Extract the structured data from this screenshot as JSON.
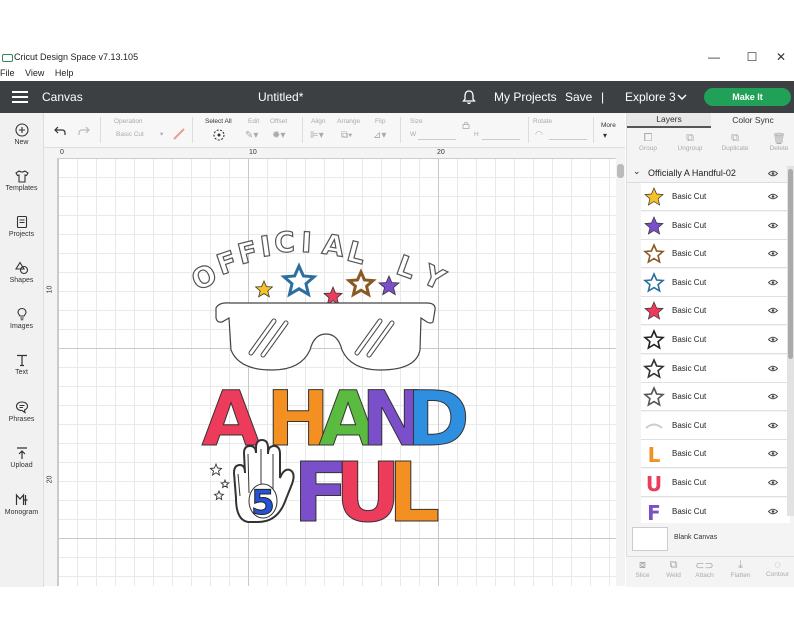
{
  "window": {
    "title": "Cricut Design Space  v7.13.105",
    "menu": [
      "File",
      "View",
      "Help"
    ],
    "controls": [
      "—",
      "☐",
      "✕"
    ]
  },
  "header": {
    "canvas_label": "Canvas",
    "doc_title": "Untitled*",
    "my_projects": "My Projects",
    "save": "Save",
    "divider": "|",
    "machine": "Explore 3",
    "make_it": "Make It"
  },
  "left_toolbar": [
    {
      "label": "New",
      "icon": "plus-icon"
    },
    {
      "label": "Templates",
      "icon": "shirt-icon"
    },
    {
      "label": "Projects",
      "icon": "projects-icon"
    },
    {
      "label": "Shapes",
      "icon": "shapes-icon"
    },
    {
      "label": "Images",
      "icon": "bulb-icon"
    },
    {
      "label": "Text",
      "icon": "text-icon"
    },
    {
      "label": "Phrases",
      "icon": "chat-icon"
    },
    {
      "label": "Upload",
      "icon": "upload-icon"
    },
    {
      "label": "Monogram",
      "icon": "monogram-icon"
    }
  ],
  "edit_toolbar": {
    "operation": "Operation",
    "operation_value": "Basic Cut",
    "select_all": "Select All",
    "edit": "Edit",
    "offset": "Offset",
    "align": "Align",
    "arrange": "Arrange",
    "flip": "Flip",
    "size": "Size",
    "w": "W",
    "h": "H",
    "rotate": "Rotate",
    "more": "More"
  },
  "ruler": {
    "top": [
      "0",
      "10",
      "20"
    ],
    "left": [
      "10",
      "20"
    ]
  },
  "design": {
    "top_word": "OFFICIALLY",
    "line2": [
      "A",
      "H",
      "A",
      "N",
      "D"
    ],
    "line3": [
      "F",
      "U",
      "L"
    ],
    "hand_number": "5",
    "colors": {
      "red": "#ec3b5b",
      "orange": "#f48f22",
      "green": "#5bbb41",
      "blue": "#2e8fe0",
      "purple": "#7b4fc9",
      "yellow": "#f6c22a",
      "dark_blue": "#2453d8"
    }
  },
  "panel": {
    "tabs": [
      "Layers",
      "Color Sync"
    ],
    "tools": [
      "Group",
      "Ungroup",
      "Duplicate",
      "Delete"
    ],
    "group_name": "Officially A Handful-02",
    "layers": [
      {
        "name": "Basic Cut",
        "thumb": "star",
        "color": "#f6c22a"
      },
      {
        "name": "Basic Cut",
        "thumb": "star",
        "color": "#7b4fc9"
      },
      {
        "name": "Basic Cut",
        "thumb": "star-outline",
        "color": "#8a5a24"
      },
      {
        "name": "Basic Cut",
        "thumb": "star-outline",
        "color": "#2b6f9e"
      },
      {
        "name": "Basic Cut",
        "thumb": "star",
        "color": "#ec3b5b"
      },
      {
        "name": "Basic Cut",
        "thumb": "star-outline",
        "color": "#222222"
      },
      {
        "name": "Basic Cut",
        "thumb": "star-outline",
        "color": "#333333"
      },
      {
        "name": "Basic Cut",
        "thumb": "star-outline",
        "color": "#555555"
      },
      {
        "name": "Basic Cut",
        "thumb": "arc",
        "color": "#cccccc"
      },
      {
        "name": "Basic Cut",
        "thumb": "L",
        "color": "#f48f22"
      },
      {
        "name": "Basic Cut",
        "thumb": "U",
        "color": "#ec3b5b"
      },
      {
        "name": "Basic Cut",
        "thumb": "F",
        "color": "#7b4fc9"
      }
    ],
    "blank_canvas": "Blank Canvas",
    "bottom_tools": [
      "Slice",
      "Weld",
      "Attach",
      "Flatten",
      "Contour"
    ]
  }
}
